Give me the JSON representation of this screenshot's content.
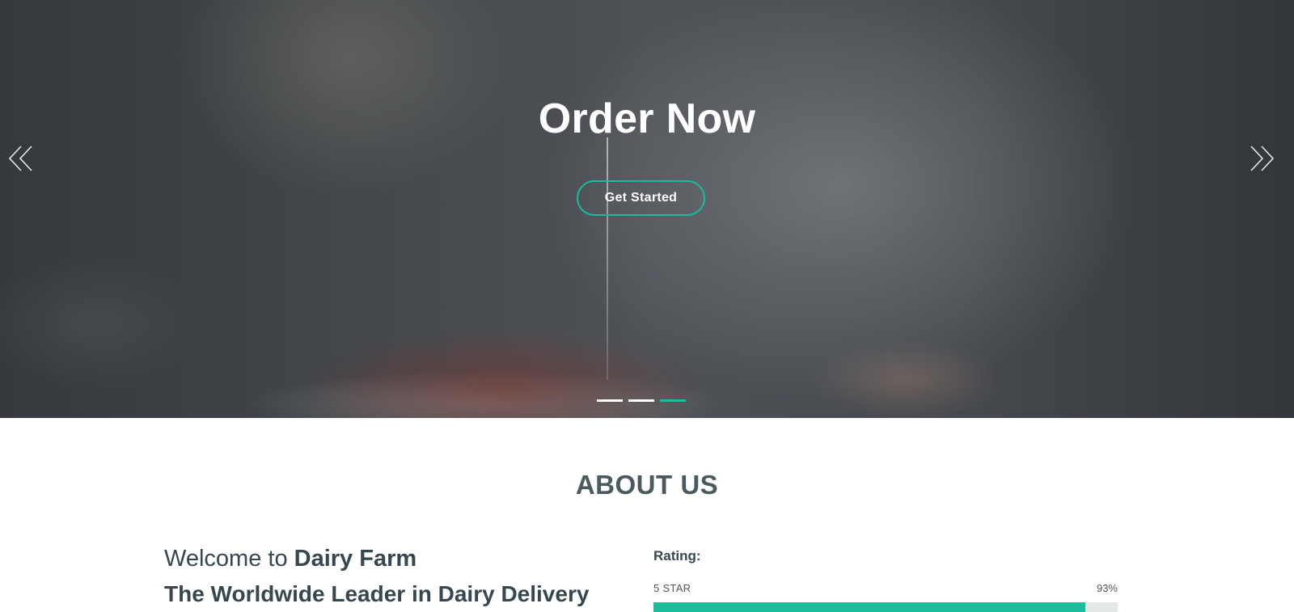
{
  "hero": {
    "title": "Order Now",
    "button_label": "Get Started",
    "prev_icon": "double-chevron-left-icon",
    "next_icon": "double-chevron-right-icon",
    "slide_count": 3,
    "active_slide": 3,
    "accent_color": "#1bbc9b"
  },
  "about": {
    "section_title": "ABOUT US",
    "welcome_prefix": "Welcome to ",
    "welcome_brand": "Dairy Farm",
    "subtitle": "The Worldwide Leader in Dairy Delivery",
    "rating_label": "Rating:",
    "bars": [
      {
        "name": "5 STAR",
        "percent_label": "93%",
        "percent": 93
      }
    ]
  }
}
